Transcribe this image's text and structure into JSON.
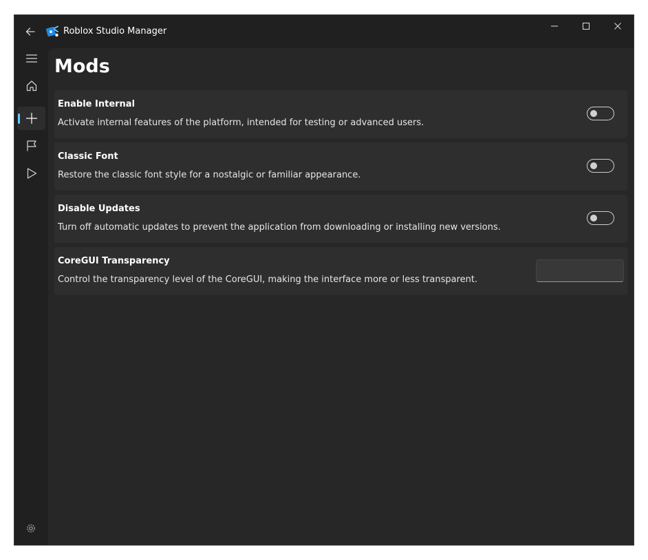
{
  "titlebar": {
    "app_title": "Roblox Studio Manager",
    "back_icon": "arrow-left-icon",
    "app_icon": "roblox-studio-icon",
    "controls": [
      "minimize-icon",
      "maximize-icon",
      "close-icon"
    ]
  },
  "nav": {
    "items": [
      {
        "icon": "hamburger-menu-icon"
      },
      {
        "icon": "home-icon"
      },
      {
        "icon": "plus-icon",
        "selected": true
      },
      {
        "icon": "flag-icon"
      },
      {
        "icon": "play-icon"
      }
    ],
    "footer_icon": "settings-gear-icon"
  },
  "page": {
    "title": "Mods",
    "settings": [
      {
        "title": "Enable Internal",
        "description": "Activate internal features of the platform, intended for testing or advanced users.",
        "control": "toggle",
        "on": false
      },
      {
        "title": "Classic Font",
        "description": "Restore the classic font style for a nostalgic or familiar appearance.",
        "control": "toggle",
        "on": false
      },
      {
        "title": "Disable Updates",
        "description": "Turn off automatic updates to prevent the application from downloading or installing new versions.",
        "control": "toggle",
        "on": false
      },
      {
        "title": "CoreGUI Transparency",
        "description": "Control the transparency level of the CoreGUI, making the interface more or less transparent.",
        "control": "number-input",
        "value": ""
      }
    ]
  },
  "colors": {
    "accent": "#60cdff",
    "window_bg": "#202020",
    "content_bg": "#272727",
    "card_bg": "#2e2e2e"
  }
}
